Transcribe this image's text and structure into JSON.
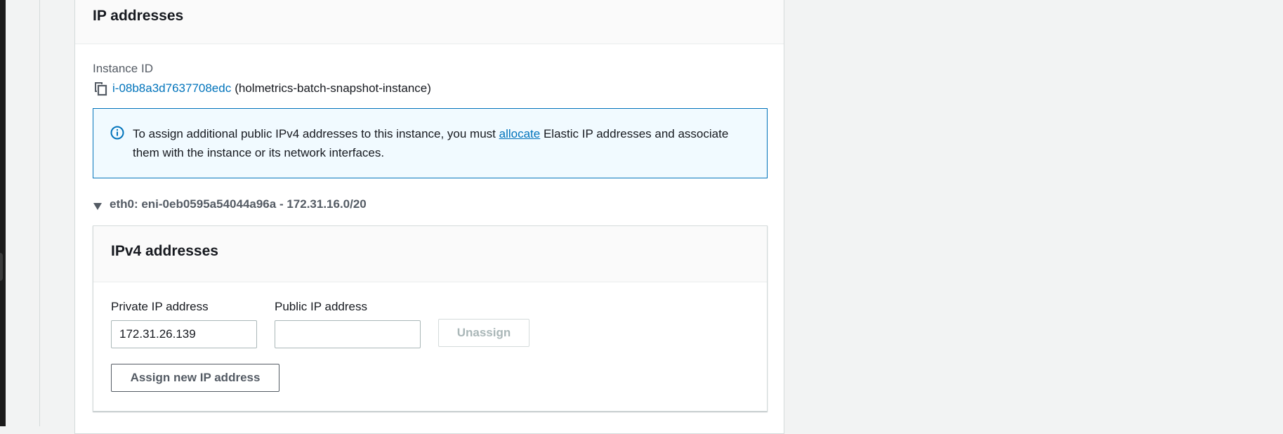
{
  "section": {
    "title": "IP addresses",
    "instance_label": "Instance ID",
    "instance_id": "i-08b8a3d7637708edc",
    "instance_name": "(holmetrics-batch-snapshot-instance)"
  },
  "alert": {
    "text_before": "To assign additional public IPv4 addresses to this instance, you must ",
    "link_text": "allocate",
    "text_after": " Elastic IP addresses and associate them with the instance or its network interfaces."
  },
  "interface": {
    "label": "eth0: eni-0eb0595a54044a96a - 172.31.16.0/20"
  },
  "ipv4": {
    "title": "IPv4 addresses",
    "private_label": "Private IP address",
    "private_value": "172.31.26.139",
    "public_label": "Public IP address",
    "public_value": "",
    "unassign_label": "Unassign",
    "assign_label": "Assign new IP address"
  },
  "colors": {
    "link": "#0073bb",
    "alert_bg": "#f1faff",
    "alert_border": "#0073bb"
  }
}
